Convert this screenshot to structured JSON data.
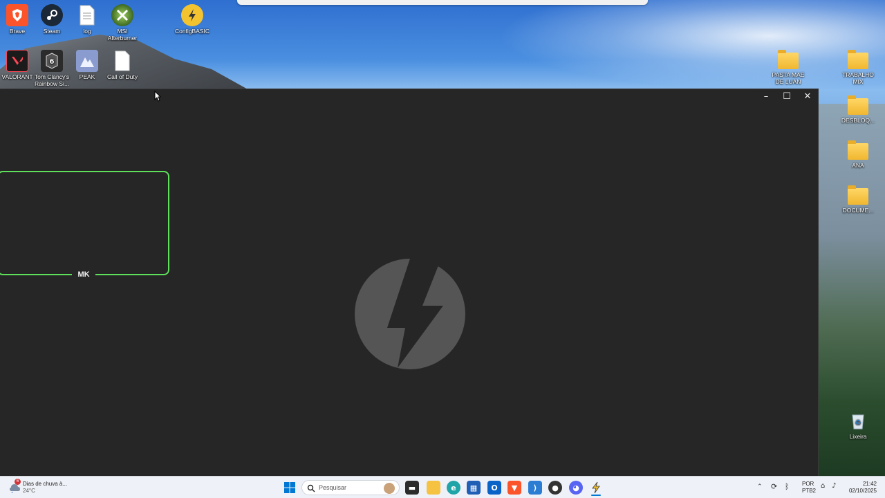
{
  "desktop": {
    "icons": [
      {
        "label": "Brave",
        "color": "#fb542b"
      },
      {
        "label": "Steam",
        "color": "#1b2838"
      },
      {
        "label": "log",
        "color": "#ffffff"
      },
      {
        "label": "MSI Afterburner",
        "color": "#6a9a3a"
      },
      {
        "label": "ConfigBASIC",
        "color": "#f4c430"
      },
      {
        "label": "VALORANT",
        "color": "#1b1b1b"
      },
      {
        "label": "Tom Clancy's Rainbow Si...",
        "color": "#2b2b2b"
      },
      {
        "label": "PEAK",
        "color": "#8a9ccf"
      },
      {
        "label": "Call of Duty",
        "color": "#ffffff"
      },
      {
        "label": "PASTA MAE DE LUAN",
        "color": "#f0b730"
      },
      {
        "label": "TRABALHO MIX",
        "color": "#f0b730"
      },
      {
        "label": "DESBLOQ...",
        "color": "#f0b730"
      },
      {
        "label": "ANA",
        "color": "#f0b730"
      },
      {
        "label": "DOCUME...",
        "color": "#f0b730"
      },
      {
        "label": "Lixeira",
        "color": "#dde8f0"
      }
    ]
  },
  "window": {
    "card_label": "MK",
    "accent_color": "#5fe05a",
    "logo_icon": "lightning-bolt-icon",
    "controls": {
      "minimize": "–",
      "maximize": "☐",
      "close": "✕"
    }
  },
  "taskbar": {
    "weather": {
      "title": "Dias de chuva à...",
      "temp": "24°C",
      "badge": "6"
    },
    "search_placeholder": "Pesquisar",
    "language": {
      "line1": "POR",
      "line2": "PTB2"
    },
    "clock": {
      "time": "21:42",
      "date": "02/10/2025"
    }
  }
}
